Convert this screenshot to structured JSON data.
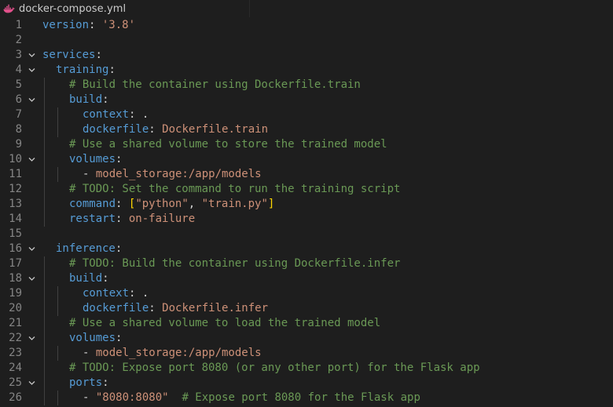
{
  "tab": {
    "icon": "docker-whale-icon",
    "title": "docker-compose.yml"
  },
  "colors": {
    "background": "#1e1e1e",
    "key": "#569cd6",
    "string": "#ce9178",
    "comment": "#6a9955",
    "punctuation": "#d4d4d4",
    "bracket": "#ffd700",
    "line_number": "#858585",
    "docker_icon": "#e0508a"
  },
  "lines": [
    {
      "n": "1",
      "indent": 0,
      "fold": false,
      "tokens": [
        {
          "t": "key",
          "v": "version"
        },
        {
          "t": "pun",
          "v": ": "
        },
        {
          "t": "str",
          "v": "'3.8'"
        }
      ]
    },
    {
      "n": "2",
      "indent": 0,
      "fold": false,
      "tokens": []
    },
    {
      "n": "3",
      "indent": 0,
      "fold": true,
      "tokens": [
        {
          "t": "key",
          "v": "services"
        },
        {
          "t": "pun",
          "v": ":"
        }
      ]
    },
    {
      "n": "4",
      "indent": 1,
      "fold": true,
      "tokens": [
        {
          "t": "key",
          "v": "training"
        },
        {
          "t": "pun",
          "v": ":"
        }
      ]
    },
    {
      "n": "5",
      "indent": 2,
      "fold": false,
      "tokens": [
        {
          "t": "cmt",
          "v": "# Build the container using Dockerfile.train"
        }
      ]
    },
    {
      "n": "6",
      "indent": 2,
      "fold": true,
      "tokens": [
        {
          "t": "key",
          "v": "build"
        },
        {
          "t": "pun",
          "v": ":"
        }
      ]
    },
    {
      "n": "7",
      "indent": 3,
      "fold": false,
      "tokens": [
        {
          "t": "key",
          "v": "context"
        },
        {
          "t": "pun",
          "v": ": ."
        }
      ]
    },
    {
      "n": "8",
      "indent": 3,
      "fold": false,
      "tokens": [
        {
          "t": "key",
          "v": "dockerfile"
        },
        {
          "t": "pun",
          "v": ": "
        },
        {
          "t": "str",
          "v": "Dockerfile.train"
        }
      ]
    },
    {
      "n": "9",
      "indent": 2,
      "fold": false,
      "tokens": [
        {
          "t": "cmt",
          "v": "# Use a shared volume to store the trained model"
        }
      ]
    },
    {
      "n": "10",
      "indent": 2,
      "fold": true,
      "tokens": [
        {
          "t": "key",
          "v": "volumes"
        },
        {
          "t": "pun",
          "v": ":"
        }
      ]
    },
    {
      "n": "11",
      "indent": 3,
      "fold": false,
      "tokens": [
        {
          "t": "pun",
          "v": "- "
        },
        {
          "t": "str",
          "v": "model_storage:/app/models"
        }
      ]
    },
    {
      "n": "12",
      "indent": 2,
      "fold": false,
      "tokens": [
        {
          "t": "cmt",
          "v": "# TODO: Set the command to run the training script"
        }
      ]
    },
    {
      "n": "13",
      "indent": 2,
      "fold": false,
      "tokens": [
        {
          "t": "key",
          "v": "command"
        },
        {
          "t": "pun",
          "v": ": "
        },
        {
          "t": "brk",
          "v": "["
        },
        {
          "t": "str",
          "v": "\"python\""
        },
        {
          "t": "pun",
          "v": ", "
        },
        {
          "t": "str",
          "v": "\"train.py\""
        },
        {
          "t": "brk",
          "v": "]"
        }
      ]
    },
    {
      "n": "14",
      "indent": 2,
      "fold": false,
      "tokens": [
        {
          "t": "key",
          "v": "restart"
        },
        {
          "t": "pun",
          "v": ": "
        },
        {
          "t": "str",
          "v": "on-failure"
        }
      ]
    },
    {
      "n": "15",
      "indent": 0,
      "fold": false,
      "tokens": []
    },
    {
      "n": "16",
      "indent": 1,
      "fold": true,
      "tokens": [
        {
          "t": "key",
          "v": "inference"
        },
        {
          "t": "pun",
          "v": ":"
        }
      ]
    },
    {
      "n": "17",
      "indent": 2,
      "fold": false,
      "tokens": [
        {
          "t": "cmt",
          "v": "# TODO: Build the container using Dockerfile.infer"
        }
      ]
    },
    {
      "n": "18",
      "indent": 2,
      "fold": true,
      "tokens": [
        {
          "t": "key",
          "v": "build"
        },
        {
          "t": "pun",
          "v": ":"
        }
      ]
    },
    {
      "n": "19",
      "indent": 3,
      "fold": false,
      "tokens": [
        {
          "t": "key",
          "v": "context"
        },
        {
          "t": "pun",
          "v": ": ."
        }
      ]
    },
    {
      "n": "20",
      "indent": 3,
      "fold": false,
      "tokens": [
        {
          "t": "key",
          "v": "dockerfile"
        },
        {
          "t": "pun",
          "v": ": "
        },
        {
          "t": "str",
          "v": "Dockerfile.infer"
        }
      ]
    },
    {
      "n": "21",
      "indent": 2,
      "fold": false,
      "tokens": [
        {
          "t": "cmt",
          "v": "# Use a shared volume to load the trained model"
        }
      ]
    },
    {
      "n": "22",
      "indent": 2,
      "fold": true,
      "tokens": [
        {
          "t": "key",
          "v": "volumes"
        },
        {
          "t": "pun",
          "v": ":"
        }
      ]
    },
    {
      "n": "23",
      "indent": 3,
      "fold": false,
      "tokens": [
        {
          "t": "pun",
          "v": "- "
        },
        {
          "t": "str",
          "v": "model_storage:/app/models"
        }
      ]
    },
    {
      "n": "24",
      "indent": 2,
      "fold": false,
      "tokens": [
        {
          "t": "cmt",
          "v": "# TODO: Expose port 8080 (or any other port) for the Flask app"
        }
      ]
    },
    {
      "n": "25",
      "indent": 2,
      "fold": true,
      "tokens": [
        {
          "t": "key",
          "v": "ports"
        },
        {
          "t": "pun",
          "v": ":"
        }
      ]
    },
    {
      "n": "26",
      "indent": 3,
      "fold": false,
      "tokens": [
        {
          "t": "pun",
          "v": "- "
        },
        {
          "t": "str",
          "v": "\"8080:8080\""
        },
        {
          "t": "pun",
          "v": "  "
        },
        {
          "t": "cmt",
          "v": "# Expose port 8080 for the Flask app"
        }
      ]
    }
  ]
}
